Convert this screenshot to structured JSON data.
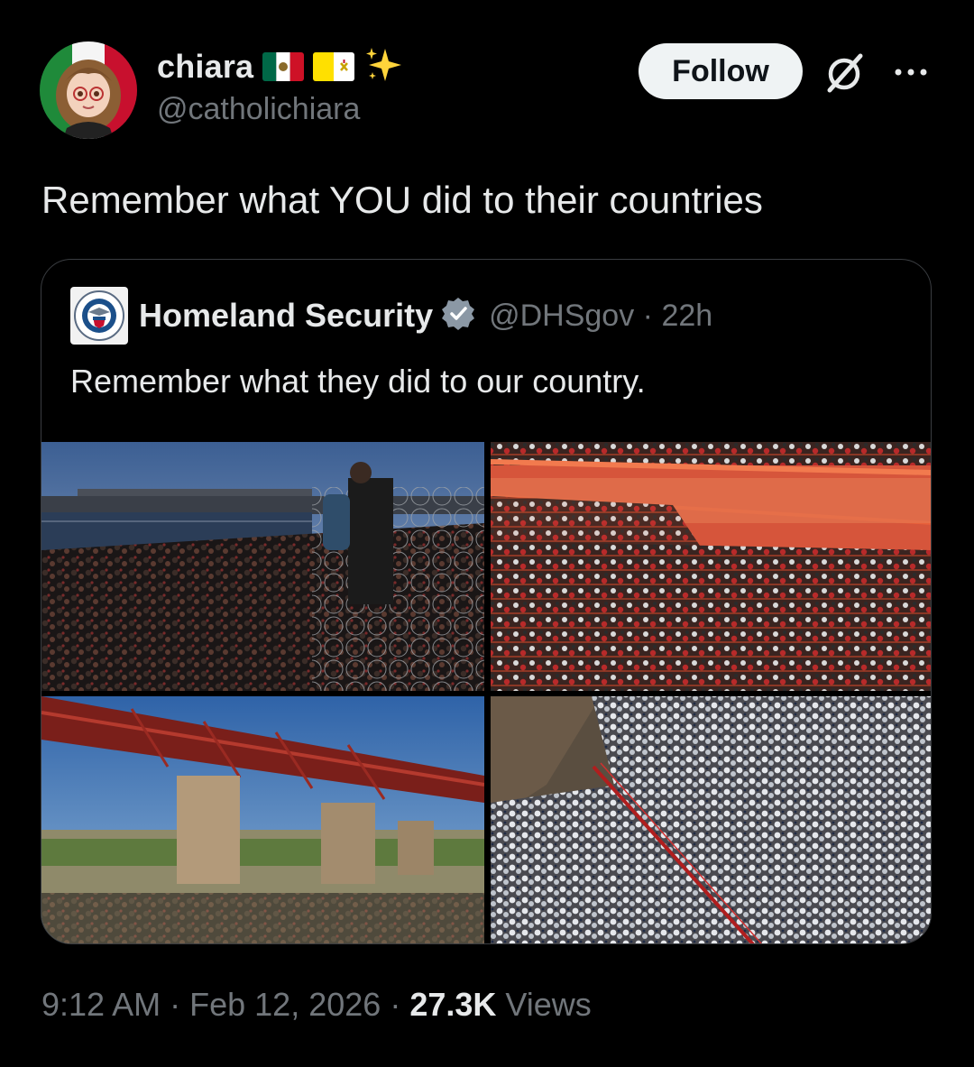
{
  "tweet": {
    "author": {
      "display_name": "chiara",
      "emoji_badges": [
        "mexico-flag",
        "vatican-flag",
        "sparkles"
      ],
      "handle": "@catholichiara"
    },
    "follow_label": "Follow",
    "text": "Remember what YOU did to their countries",
    "quoted": {
      "author_name": "Homeland Security",
      "verified": true,
      "handle": "@DHSgov",
      "separator": "·",
      "age": "22h",
      "text": "Remember what they did to our country.",
      "media": [
        {
          "icon": "photo-migrants-at-river-razor-wire"
        },
        {
          "icon": "photo-crowd-behind-orange-fence"
        },
        {
          "icon": "photo-red-railroad-bridge-over-river"
        },
        {
          "icon": "photo-crowd-in-foil-blankets"
        }
      ]
    },
    "time": "9:12 AM",
    "separator": "·",
    "date": "Feb 12, 2026",
    "views_count": "27.3K",
    "views_label": "Views"
  },
  "colors": {
    "background": "#000000",
    "primary_text": "#e7e9ea",
    "secondary_text": "#71767b",
    "follow_button_bg": "#eff3f4",
    "border": "#3a3d41",
    "verified_badge": "#8b98a5"
  }
}
